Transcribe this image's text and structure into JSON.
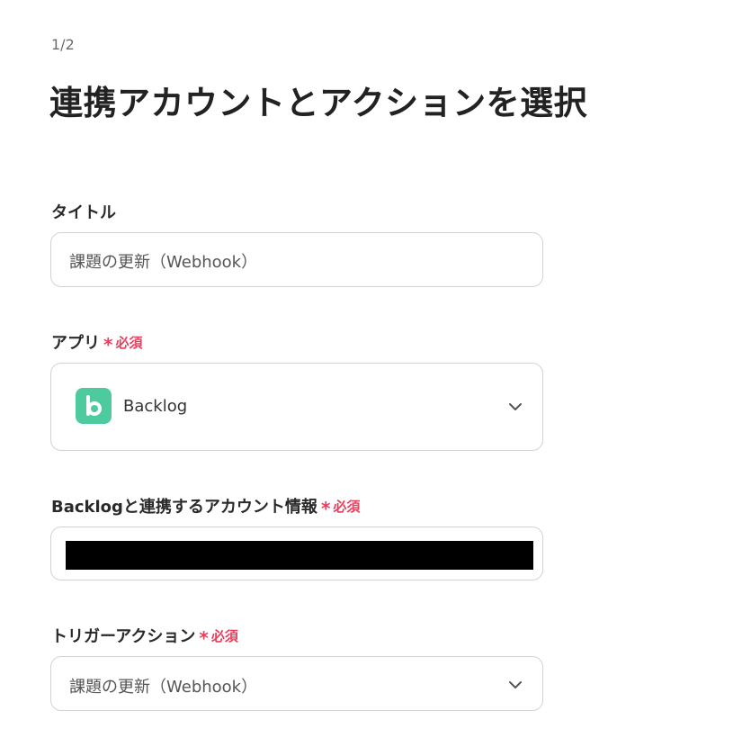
{
  "header": {
    "step": "1/2",
    "title": "連携アカウントとアクションを選択"
  },
  "required_text": "必須",
  "colors": {
    "required": "#e5405e",
    "app_icon": "#4dcb9e"
  },
  "fields": {
    "title": {
      "label": "タイトル",
      "value": "課題の更新（Webhook）"
    },
    "app": {
      "label": "アプリ",
      "value": "Backlog",
      "icon": "backlog-logo-icon"
    },
    "account": {
      "label": "Backlogと連携するアカウント情報",
      "value_redacted": true
    },
    "trigger": {
      "label": "トリガーアクション",
      "value": "課題の更新（Webhook）"
    }
  }
}
